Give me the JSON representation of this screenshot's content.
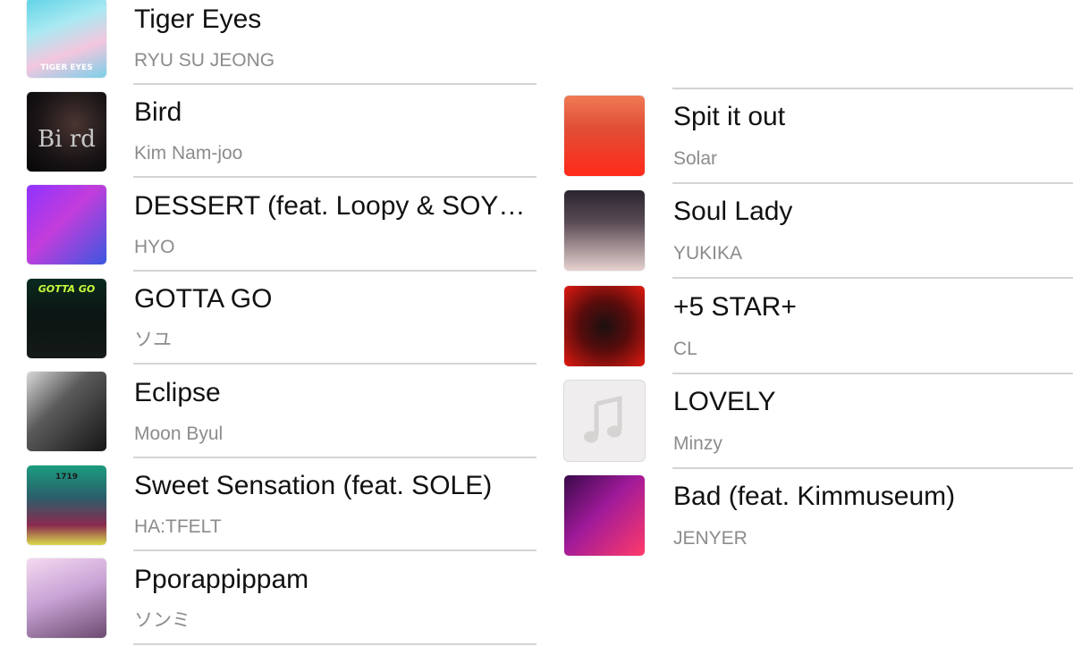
{
  "left_column": [
    {
      "title": "Tiger Eyes",
      "artist": "RYU SU JEONG",
      "art_icon": "album-art-tiger-eyes",
      "art_caption": "TIGER EYES"
    },
    {
      "title": "Bird",
      "artist": "Kim Nam-joo",
      "art_icon": "album-art-bird"
    },
    {
      "title": "DESSERT (feat. Loopy & SOYEON ((G)I-DLE))",
      "artist": "HYO",
      "art_icon": "album-art-dessert"
    },
    {
      "title": "GOTTA GO",
      "artist": "ソユ",
      "art_icon": "album-art-gotta-go",
      "art_caption": "GOTTA GO"
    },
    {
      "title": "Eclipse",
      "artist": "Moon Byul",
      "art_icon": "album-art-eclipse"
    },
    {
      "title": "Sweet Sensation (feat. SOLE)",
      "artist": "HA:TFELT",
      "art_icon": "album-art-sweet-sensation",
      "art_caption": "1719"
    },
    {
      "title": "Pporappippam",
      "artist": "ソンミ",
      "art_icon": "album-art-pporappippam"
    }
  ],
  "right_column": [
    {
      "title": "Spit it out",
      "artist": "Solar",
      "art_icon": "album-art-spit-it-out"
    },
    {
      "title": "Soul Lady",
      "artist": "YUKIKA",
      "art_icon": "album-art-soul-lady"
    },
    {
      "title": "+5 STAR+",
      "artist": "CL",
      "art_icon": "album-art-5-star"
    },
    {
      "title": "LOVELY",
      "artist": "Minzy",
      "art_icon": "music-note-icon"
    },
    {
      "title": "Bad (feat. Kimmuseum)",
      "artist": "JENYER",
      "art_icon": "album-art-bad"
    }
  ],
  "colors": {
    "title": "#111111",
    "artist": "#8c8c8c",
    "separator": "#d4d4d4",
    "placeholder_bg": "#efeded",
    "placeholder_note": "#d6d3d3"
  }
}
